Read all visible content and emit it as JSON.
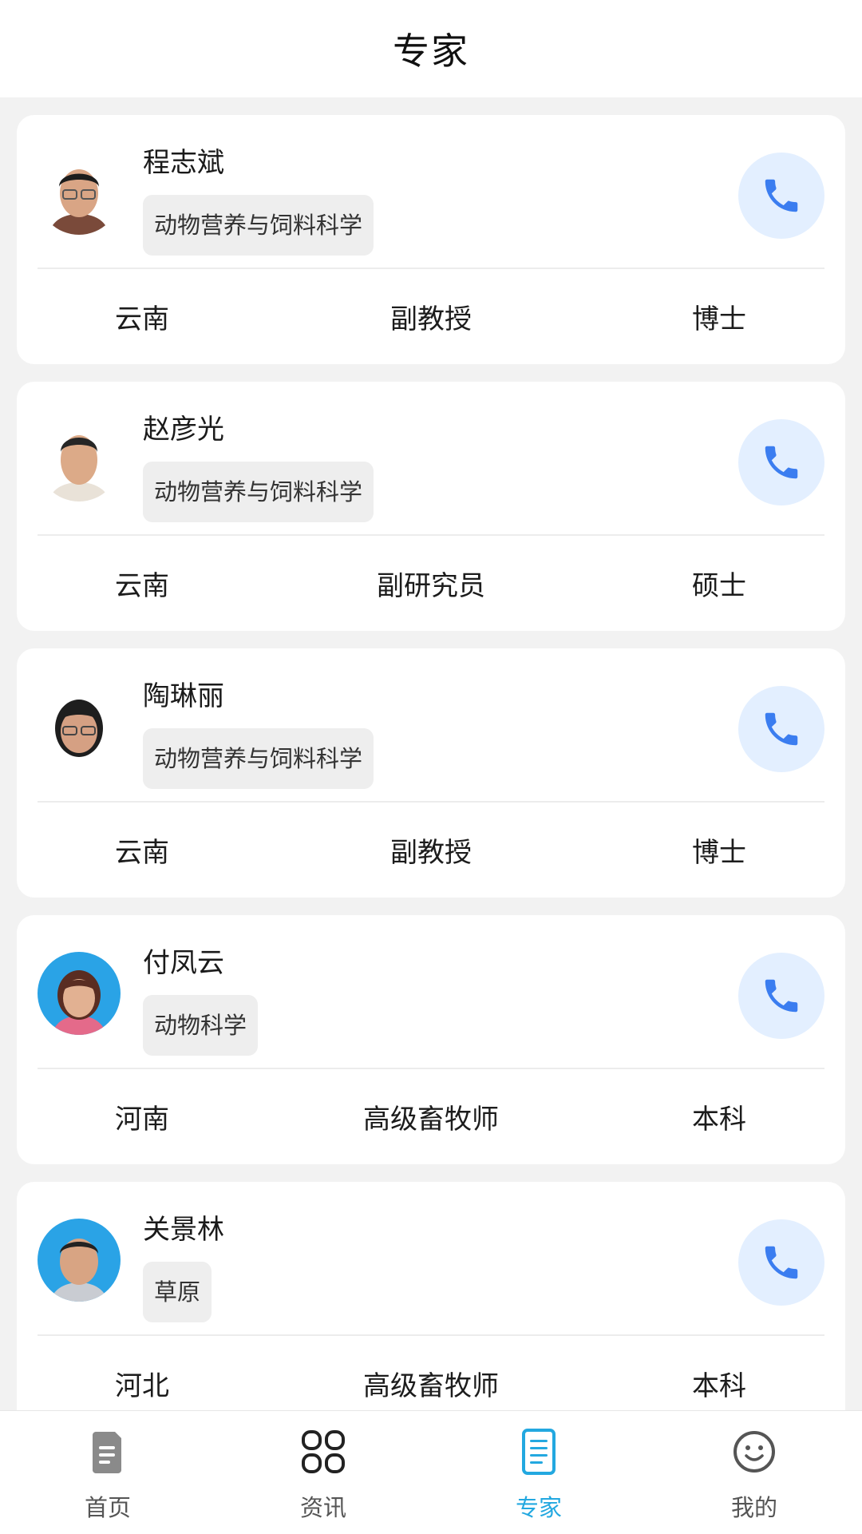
{
  "header": {
    "title": "专家"
  },
  "experts": [
    {
      "name": "程志斌",
      "field": "动物营养与饲料科学",
      "region": "云南",
      "title": "副教授",
      "degree": "博士"
    },
    {
      "name": "赵彦光",
      "field": "动物营养与饲料科学",
      "region": "云南",
      "title": "副研究员",
      "degree": "硕士"
    },
    {
      "name": "陶琳丽",
      "field": "动物营养与饲料科学",
      "region": "云南",
      "title": "副教授",
      "degree": "博士"
    },
    {
      "name": "付凤云",
      "field": "动物科学",
      "region": "河南",
      "title": "高级畜牧师",
      "degree": "本科"
    },
    {
      "name": "关景林",
      "field": "草原",
      "region": "河北",
      "title": "高级畜牧师",
      "degree": "本科"
    }
  ],
  "tabbar": {
    "tabs": [
      {
        "label": "首页",
        "icon": "document-icon"
      },
      {
        "label": "资讯",
        "icon": "grid-icon"
      },
      {
        "label": "专家",
        "icon": "list-document-icon",
        "active": true
      },
      {
        "label": "我的",
        "icon": "smiley-icon"
      }
    ]
  },
  "colors": {
    "accent": "#23a8e0",
    "phone": "#3b7df0",
    "phone_bg": "#e3efff"
  }
}
